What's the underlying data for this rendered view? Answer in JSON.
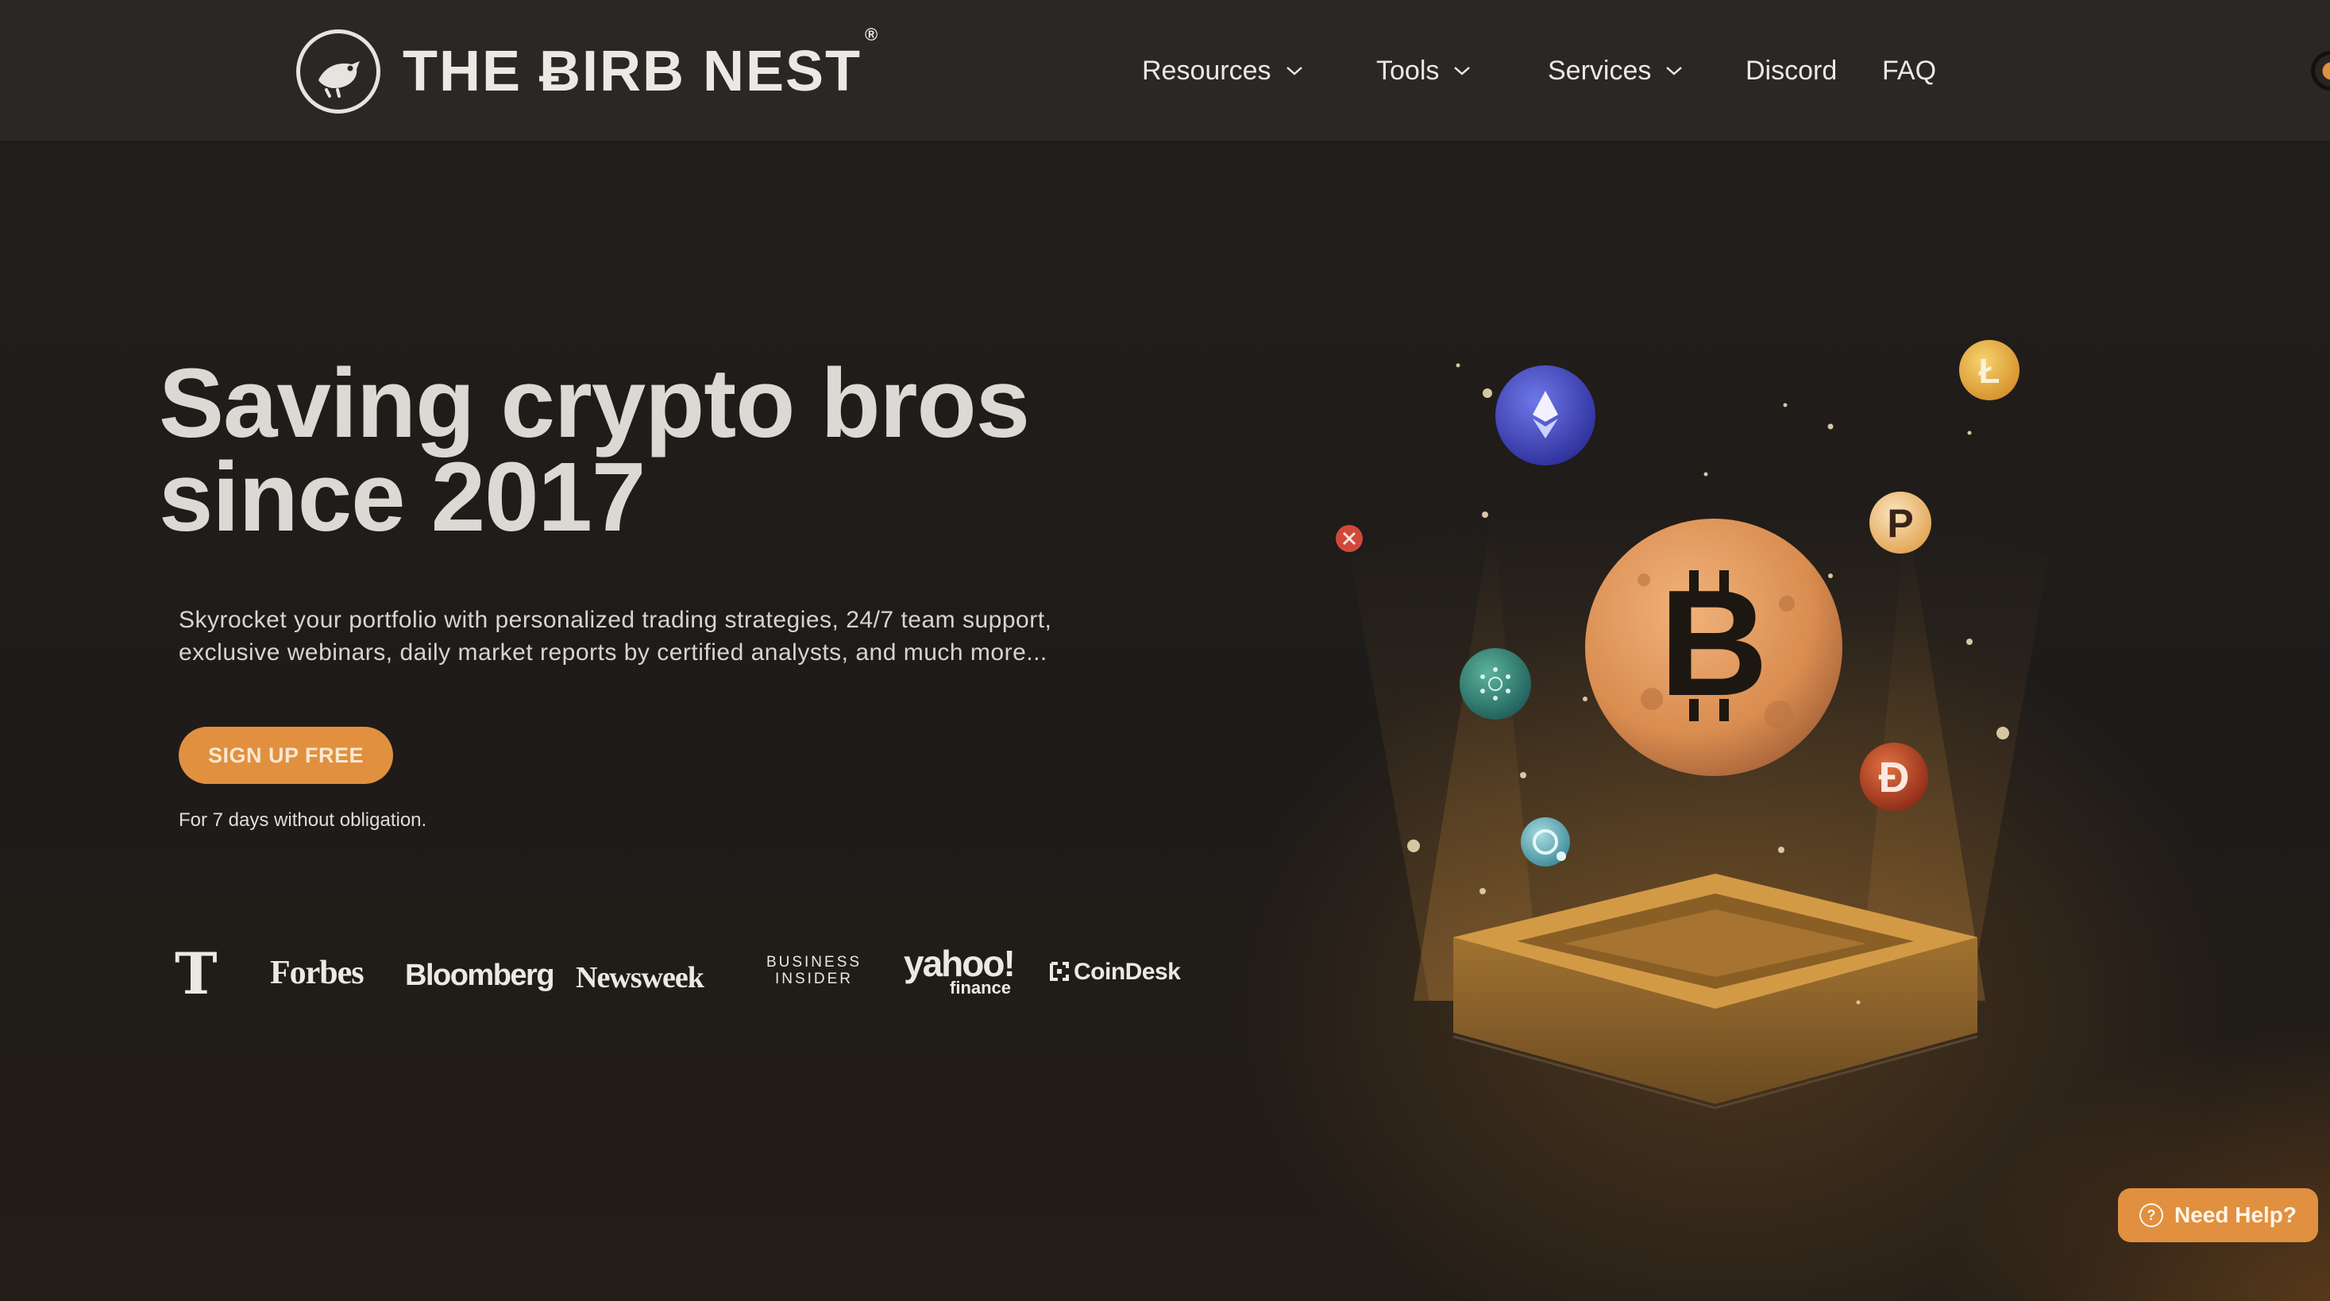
{
  "brand": {
    "name": "THE ɃIRB NEST",
    "registered": "®",
    "badge_text": "THE BIRB NEST"
  },
  "nav": {
    "resources": "Resources",
    "tools": "Tools",
    "services": "Services",
    "discord": "Discord",
    "faq": "FAQ",
    "theme_toggle_icon": "moon-icon"
  },
  "hero": {
    "title_line1": "Saving crypto bros",
    "title_line2": "since 2017",
    "subtitle_line1": "Skyrocket your portfolio with personalized trading strategies, 24/7 team support,",
    "subtitle_line2": "exclusive webinars, daily market reports by certified analysts, and much more...",
    "cta_label": "SIGN UP FREE",
    "cta_note": "For 7 days without obligation."
  },
  "press": {
    "nyt": "T",
    "forbes": "Forbes",
    "bloomberg": "Bloomberg",
    "newsweek": "Newsweek",
    "business_insider_line1": "BUSINESS",
    "business_insider_line2": "INSIDER",
    "yahoo": "yahoo!",
    "yahoo_sub": "finance",
    "coindesk": "CoinDesk"
  },
  "coins": {
    "bitcoin": "B",
    "ethereum": "ethereum-icon",
    "litecoin": "Ł",
    "polkadot": "P",
    "dogecoin": "Ð",
    "cardano": "cardano-icon",
    "xrp": "xrp-icon"
  },
  "help": {
    "label": "Need Help?",
    "icon": "?"
  },
  "colors": {
    "accent": "#e0903f",
    "background": "#1f1c1a",
    "header": "#2a2725"
  }
}
